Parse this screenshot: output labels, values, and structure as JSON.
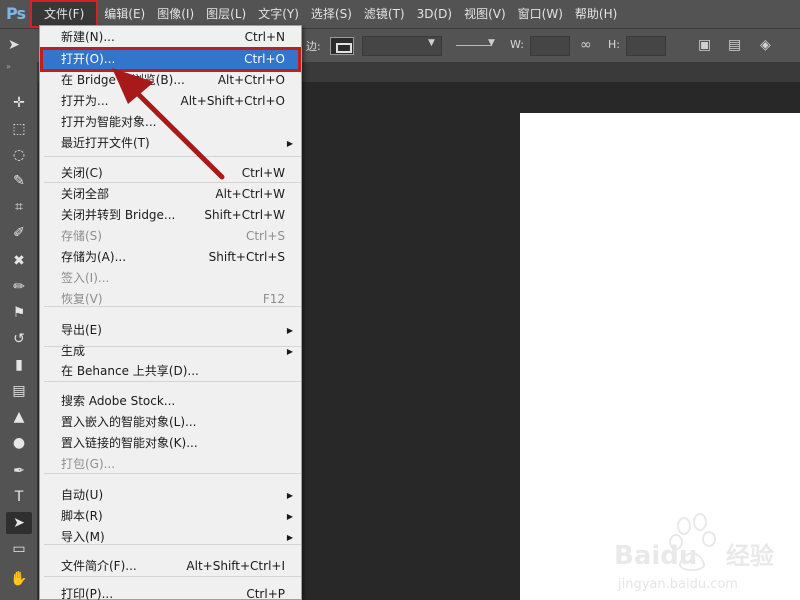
{
  "app": {
    "logo": "Ps"
  },
  "menubar": {
    "items": [
      "文件(F)",
      "编辑(E)",
      "图像(I)",
      "图层(L)",
      "文字(Y)",
      "选择(S)",
      "滤镜(T)",
      "3D(D)",
      "视图(V)",
      "窗口(W)",
      "帮助(H)"
    ],
    "active_index": 0
  },
  "options_bar": {
    "stroke_label": "边:",
    "w_label": "W:",
    "h_label": "H:"
  },
  "file_menu": [
    {
      "label": "新建(N)...",
      "shortcut": "Ctrl+N"
    },
    {
      "label": "打开(O)...",
      "shortcut": "Ctrl+O",
      "highlighted": true
    },
    {
      "label": "在 Bridge 中浏览(B)...",
      "shortcut": "Alt+Ctrl+O"
    },
    {
      "label": "打开为...",
      "shortcut": "Alt+Shift+Ctrl+O"
    },
    {
      "label": "打开为智能对象...",
      "shortcut": ""
    },
    {
      "label": "最近打开文件(T)",
      "shortcut": "",
      "submenu": true
    },
    {
      "label": "关闭(C)",
      "shortcut": "Ctrl+W"
    },
    {
      "label": "关闭全部",
      "shortcut": "Alt+Ctrl+W"
    },
    {
      "label": "关闭并转到 Bridge...",
      "shortcut": "Shift+Ctrl+W"
    },
    {
      "label": "存储(S)",
      "shortcut": "Ctrl+S",
      "disabled": true
    },
    {
      "label": "存储为(A)...",
      "shortcut": "Shift+Ctrl+S"
    },
    {
      "label": "签入(I)...",
      "shortcut": "",
      "disabled": true
    },
    {
      "label": "恢复(V)",
      "shortcut": "F12",
      "disabled": true
    },
    {
      "label": "导出(E)",
      "shortcut": "",
      "submenu": true
    },
    {
      "label": "生成",
      "shortcut": "",
      "submenu": true
    },
    {
      "label": "在 Behance 上共享(D)...",
      "shortcut": ""
    },
    {
      "label": "搜索 Adobe Stock...",
      "shortcut": ""
    },
    {
      "label": "置入嵌入的智能对象(L)...",
      "shortcut": ""
    },
    {
      "label": "置入链接的智能对象(K)...",
      "shortcut": ""
    },
    {
      "label": "打包(G)...",
      "shortcut": "",
      "disabled": true
    },
    {
      "label": "自动(U)",
      "shortcut": "",
      "submenu": true
    },
    {
      "label": "脚本(R)",
      "shortcut": "",
      "submenu": true
    },
    {
      "label": "导入(M)",
      "shortcut": "",
      "submenu": true
    },
    {
      "label": "文件简介(F)...",
      "shortcut": "Alt+Shift+Ctrl+I"
    },
    {
      "label": "打印(P)...",
      "shortcut": "Ctrl+P"
    }
  ],
  "tools": [
    "move-tool",
    "marquee-tool",
    "lasso-tool",
    "quick-selection-tool",
    "crop-tool",
    "eyedropper-tool",
    "healing-brush-tool",
    "brush-tool",
    "clone-stamp-tool",
    "history-brush-tool",
    "eraser-tool",
    "gradient-tool",
    "blur-tool",
    "dodge-tool",
    "pen-tool",
    "type-tool",
    "path-selection-tool",
    "rectangle-tool",
    "hand-tool"
  ],
  "watermark": {
    "brand": "Baidu",
    "brand_cn": "经验",
    "url": "jingyan.baidu.com"
  },
  "colors": {
    "ui_panel": "#535353",
    "workspace": "#282828",
    "menu_bg": "#f0f0f0",
    "highlight": "#3475cc",
    "annotation": "#c21d1d"
  }
}
